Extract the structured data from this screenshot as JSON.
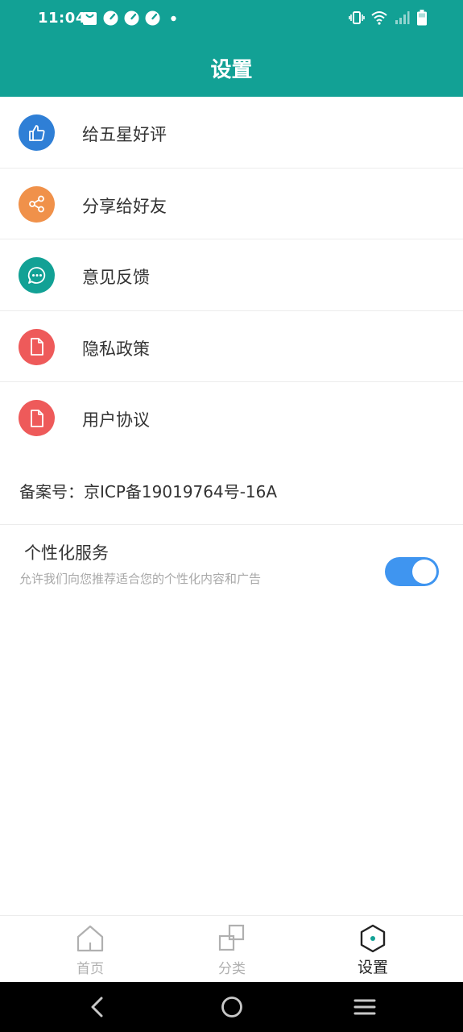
{
  "status_bar": {
    "time": "11:04",
    "left_icons": [
      "shopping-bag-icon",
      "speedometer-icon",
      "speedometer-icon",
      "speedometer-icon",
      "dot-icon"
    ],
    "right_icons": [
      "vibrate-icon",
      "wifi-icon",
      "signal-icon",
      "battery-icon"
    ]
  },
  "header": {
    "title": "设置"
  },
  "menu": {
    "items": [
      {
        "label": "给五星好评",
        "icon": "thumbs-up-icon",
        "color": "#2f7fd6"
      },
      {
        "label": "分享给好友",
        "icon": "share-icon",
        "color": "#f0914a"
      },
      {
        "label": "意见反馈",
        "icon": "chat-icon",
        "color": "#12a195"
      },
      {
        "label": "隐私政策",
        "icon": "document-icon",
        "color": "#ee5a5a"
      },
      {
        "label": "用户协议",
        "icon": "document-icon",
        "color": "#ee5a5a"
      }
    ]
  },
  "icp": {
    "text": "备案号：京ICP备19019764号-16A"
  },
  "personalization": {
    "title": "个性化服务",
    "description": "允许我们向您推荐适合您的个性化内容和广告",
    "enabled": true,
    "toggle_color": "#3f95f0"
  },
  "tabbar": {
    "tabs": [
      {
        "label": "首页",
        "icon": "home-icon",
        "active": false
      },
      {
        "label": "分类",
        "icon": "category-icon",
        "active": false
      },
      {
        "label": "设置",
        "icon": "settings-hex-icon",
        "active": true
      }
    ]
  },
  "nav_bar": {
    "buttons": [
      "back-icon",
      "home-circle-icon",
      "menu-icon"
    ]
  },
  "colors": {
    "primary": "#12a195",
    "divider": "#ececec"
  }
}
